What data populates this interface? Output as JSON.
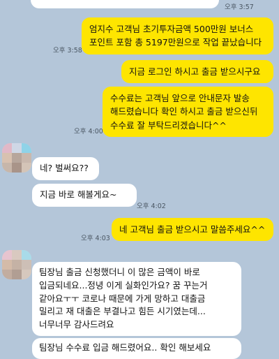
{
  "chat": {
    "messages": [
      {
        "id": "m0",
        "side": "left",
        "text": ""
      },
      {
        "id": "m1",
        "side": "right",
        "time": "오후 3:58",
        "lines": [
          "엄지수 고객님 초기투자금액 500만원 보너스",
          "포인트 포함 총 5197만원으로 작업 끝났습니다"
        ]
      },
      {
        "id": "m2",
        "side": "right",
        "lines": [
          "지금 로그인 하시고 출금 받으시구요"
        ]
      },
      {
        "id": "m3",
        "side": "right",
        "time": "오후 4:00",
        "lines": [
          "수수료는 고객님 앞으로 안내문자 발송",
          "해드렸습니다 확인 하시고 출금 받으신뒤",
          "수수료 잘 부탁드리겠습니다^^"
        ]
      },
      {
        "id": "m4",
        "side": "left",
        "lines": [
          "네? 벌써요??"
        ]
      },
      {
        "id": "m5",
        "side": "left",
        "time": "오후 4:02",
        "lines": [
          "지금 바로 해볼게요~"
        ]
      },
      {
        "id": "m6",
        "side": "right",
        "time": "오후 4:03",
        "lines": [
          "네 고객님 출금 받으시고 말씀주세요^^"
        ]
      },
      {
        "id": "m7",
        "side": "left",
        "lines": [
          "팀장님 출금 신청했더니 이 많은 금액이 바로",
          "입금되네요...정녕 이게 실화인가요? 꿈 꾸는거",
          "같아요ㅜㅜ 코로나 때문에 가게 망하고 대출금",
          "밀리고 재 대출은 부결나고 힘든 시기였는데...",
          "너무너무 감사드려요"
        ]
      },
      {
        "id": "m8",
        "side": "left",
        "lines": [
          "팀장님 수수료 입금 해드렸어요.. 확인 해보세요"
        ]
      }
    ],
    "top_time": "오후 3:57"
  },
  "colors": {
    "background": "#b4c6d9",
    "my_bubble": "#fee500",
    "their_bubble": "#ffffff"
  }
}
